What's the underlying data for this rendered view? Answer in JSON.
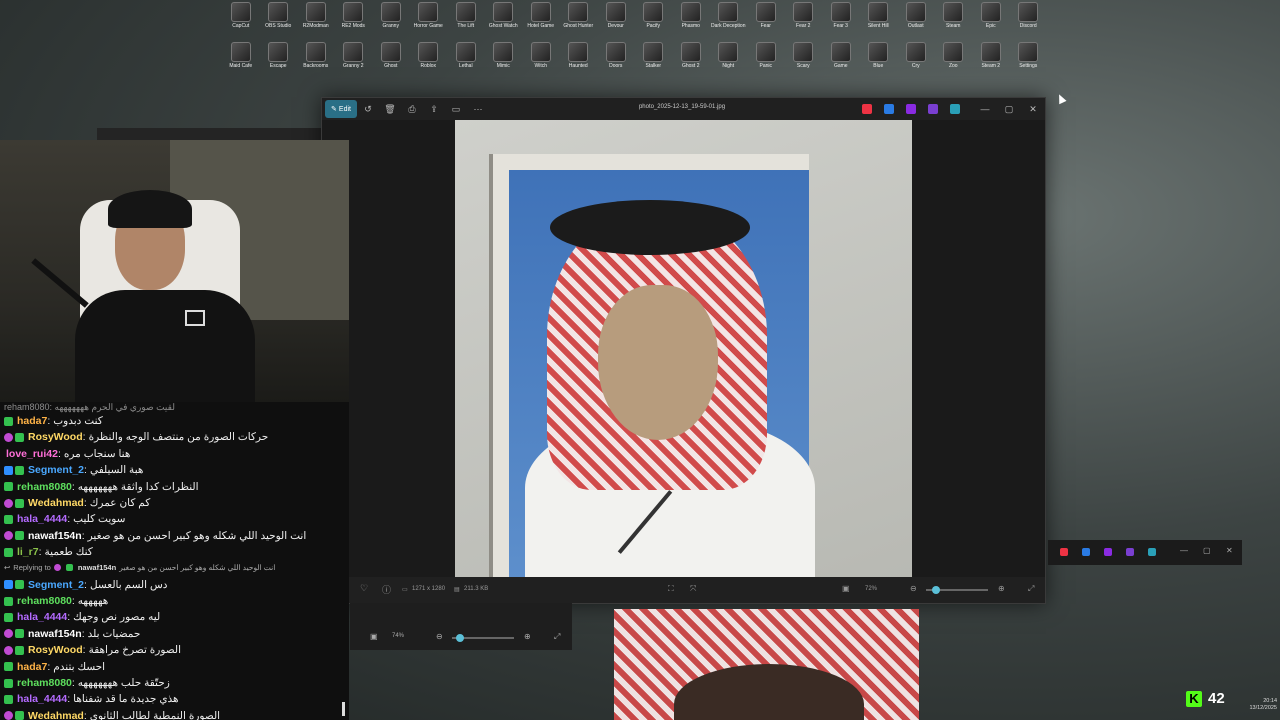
{
  "desktop": {
    "row1": [
      "CapCut",
      "OBS Studio",
      "R2Modman",
      "RE2 Mods",
      "Granny",
      "Horror Game",
      "The Lift",
      "Ghost Watch",
      "Hotel Game",
      "Ghost Hunter",
      "Devour",
      "Pacify",
      "Phasmo",
      "Dark Deception",
      "Fear",
      "Fear 2",
      "Fear 3",
      "Silent Hill",
      "Outlast",
      "Steam",
      "Epic",
      "Discord"
    ],
    "row2": [
      "Maid Cafe",
      "Escape",
      "Backrooms",
      "Granny 2",
      "Ghost",
      "Roblox",
      "Lethal",
      "Mimic",
      "Witch",
      "Haunted",
      "Doors",
      "Stalker",
      "Ghost 2",
      "Night",
      "Panic",
      "Scary",
      "Game",
      "Blue",
      "Cry",
      "Zoo",
      "Steam 2",
      "Settings"
    ]
  },
  "photo_viewer": {
    "edit_label": "Edit",
    "filename": "photo_2025-12-13_19-59-01.jpg",
    "dimensions": "1271 x 1280",
    "filesize": "211.3 KB",
    "zoom": "72%",
    "icons": {
      "rotate": "rotate-icon",
      "delete": "delete-icon",
      "print": "print-icon",
      "share": "share-icon",
      "slideshow": "slideshow-icon",
      "more": "more-icon",
      "favorite": "heart-icon",
      "info": "info-icon"
    }
  },
  "back_viewer": {
    "zoom": "74%"
  },
  "chat": {
    "top_partial": "reham8080: لقيت صوري في الحرم هههههههه",
    "messages": [
      {
        "user": "hada7",
        "color": "#ffb347",
        "badges": [
          "mod"
        ],
        "text": "كنت دبدوب"
      },
      {
        "user": "RosyWood",
        "color": "#ffd966",
        "badges": [
          "sub",
          "mod"
        ],
        "text": "حركات الصورة من منتصف الوجه والنظرة"
      },
      {
        "user": "love_rui42",
        "color": "#ff6fd8",
        "badges": [],
        "text": "هنا سنجاب مره"
      },
      {
        "user": "Segment_2",
        "color": "#4aa8ff",
        "badges": [
          "vip",
          "mod"
        ],
        "text": "هبة السيلفي"
      },
      {
        "user": "reham8080",
        "color": "#5ee05e",
        "badges": [
          "mod"
        ],
        "text": "النظرات كدا واثقة هههههههه"
      },
      {
        "user": "Wedahmad",
        "color": "#ffd966",
        "badges": [
          "sub",
          "mod"
        ],
        "text": "كم كان عمرك"
      },
      {
        "user": "hala_4444",
        "color": "#b46bff",
        "badges": [
          "mod"
        ],
        "text": "سويت كليب"
      },
      {
        "user": "nawaf154n",
        "color": "#ffffff",
        "badges": [
          "sub",
          "mod"
        ],
        "text": "انت الوحيد اللي شكله وهو كبير احسن من هو صغير"
      },
      {
        "user": "li_r7",
        "color": "#8bc34a",
        "badges": [
          "mod"
        ],
        "text": "كنك طعمية"
      },
      {
        "user": "Segment_2",
        "color": "#4aa8ff",
        "badges": [
          "vip",
          "mod"
        ],
        "text": "دس السم بالعسل"
      },
      {
        "user": "reham8080",
        "color": "#5ee05e",
        "badges": [
          "mod"
        ],
        "text": "هههههه"
      },
      {
        "user": "hala_4444",
        "color": "#b46bff",
        "badges": [
          "mod"
        ],
        "text": "ليه مصور نص وجهك"
      },
      {
        "user": "nawaf154n",
        "color": "#ffffff",
        "badges": [
          "sub",
          "mod"
        ],
        "text": "حمضيات بلد"
      },
      {
        "user": "RosyWood",
        "color": "#ffd966",
        "badges": [
          "sub",
          "mod"
        ],
        "text": "الصورة تصرخ مراهقة"
      },
      {
        "user": "hada7",
        "color": "#ffb347",
        "badges": [
          "mod"
        ],
        "text": "احسك بتندم"
      },
      {
        "user": "reham8080",
        "color": "#5ee05e",
        "badges": [
          "mod"
        ],
        "text": "زحتّقة حلب هههههههه"
      },
      {
        "user": "hala_4444",
        "color": "#b46bff",
        "badges": [
          "mod"
        ],
        "text": "هذي جديدة ما قد شفناها"
      },
      {
        "user": "Wedahmad",
        "color": "#ffd966",
        "badges": [
          "sub",
          "mod"
        ],
        "text": "الصورة النمطية لطالب الثانوي"
      }
    ],
    "reply": {
      "prefix": "Replying to",
      "user": "nawaf154n",
      "text": "انت الوحيد اللي شكله وهو كبير احسن من هو صغير"
    }
  },
  "stream": {
    "viewer_count": "42"
  },
  "clock": {
    "time": "20:14",
    "date": "13/12/2025"
  }
}
